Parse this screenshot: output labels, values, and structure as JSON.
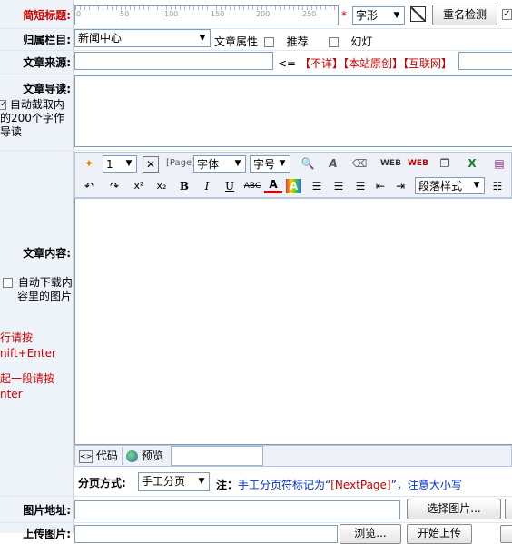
{
  "form": {
    "short_title_label": "简短标题:",
    "ruler_ticks": [
      "0",
      "50",
      "100",
      "150",
      "200",
      "250"
    ],
    "required_star": "*",
    "font_shape_select": "字形",
    "dup_check_button": "重名检测",
    "column_label": "归属栏目:",
    "column_select": "新闻中心",
    "attr_label": "文章属性",
    "attr_recommend": "推荐",
    "attr_slide": "幻灯",
    "source_label": "文章来源:",
    "source_arrow": "<=",
    "source_links": [
      "【不详】",
      "【本站原创】",
      "【互联网】"
    ],
    "intro_label": "文章导读:",
    "auto_extract_lines": [
      "自动截取内",
      "的200个字作",
      "导读"
    ],
    "content_label": "文章内容:",
    "auto_download_lines": [
      "自动下载内",
      "容里的图片"
    ],
    "hint1_lines": [
      "行请按",
      "nift+Enter"
    ],
    "hint2_lines": [
      "起一段请按",
      "nter"
    ],
    "pagination_label": "分页方式:",
    "pagination_select": "手工分页",
    "note_label": "注：",
    "note_text_pre": "手工分页符标记为“",
    "note_tag": "[NextPage]",
    "note_text_post": "”，注意大小写",
    "image_url_label": "图片地址:",
    "select_image_button": "选择图片...",
    "upload_label": "上传图片:",
    "browse_button": "浏览...",
    "start_upload_button": "开始上传"
  },
  "editor": {
    "row1": {
      "size_select": "1",
      "font_select": "字体",
      "font_size_select": "字号"
    },
    "row2": {
      "paragraph_select": "段落样式"
    },
    "tabs": {
      "code": "代码",
      "preview": "预览"
    }
  },
  "colors": {
    "label_red": "#cc0000",
    "link_blue": "#0033cc",
    "border": "#7f9db9",
    "toolbar_bg": "#eef2f8"
  }
}
